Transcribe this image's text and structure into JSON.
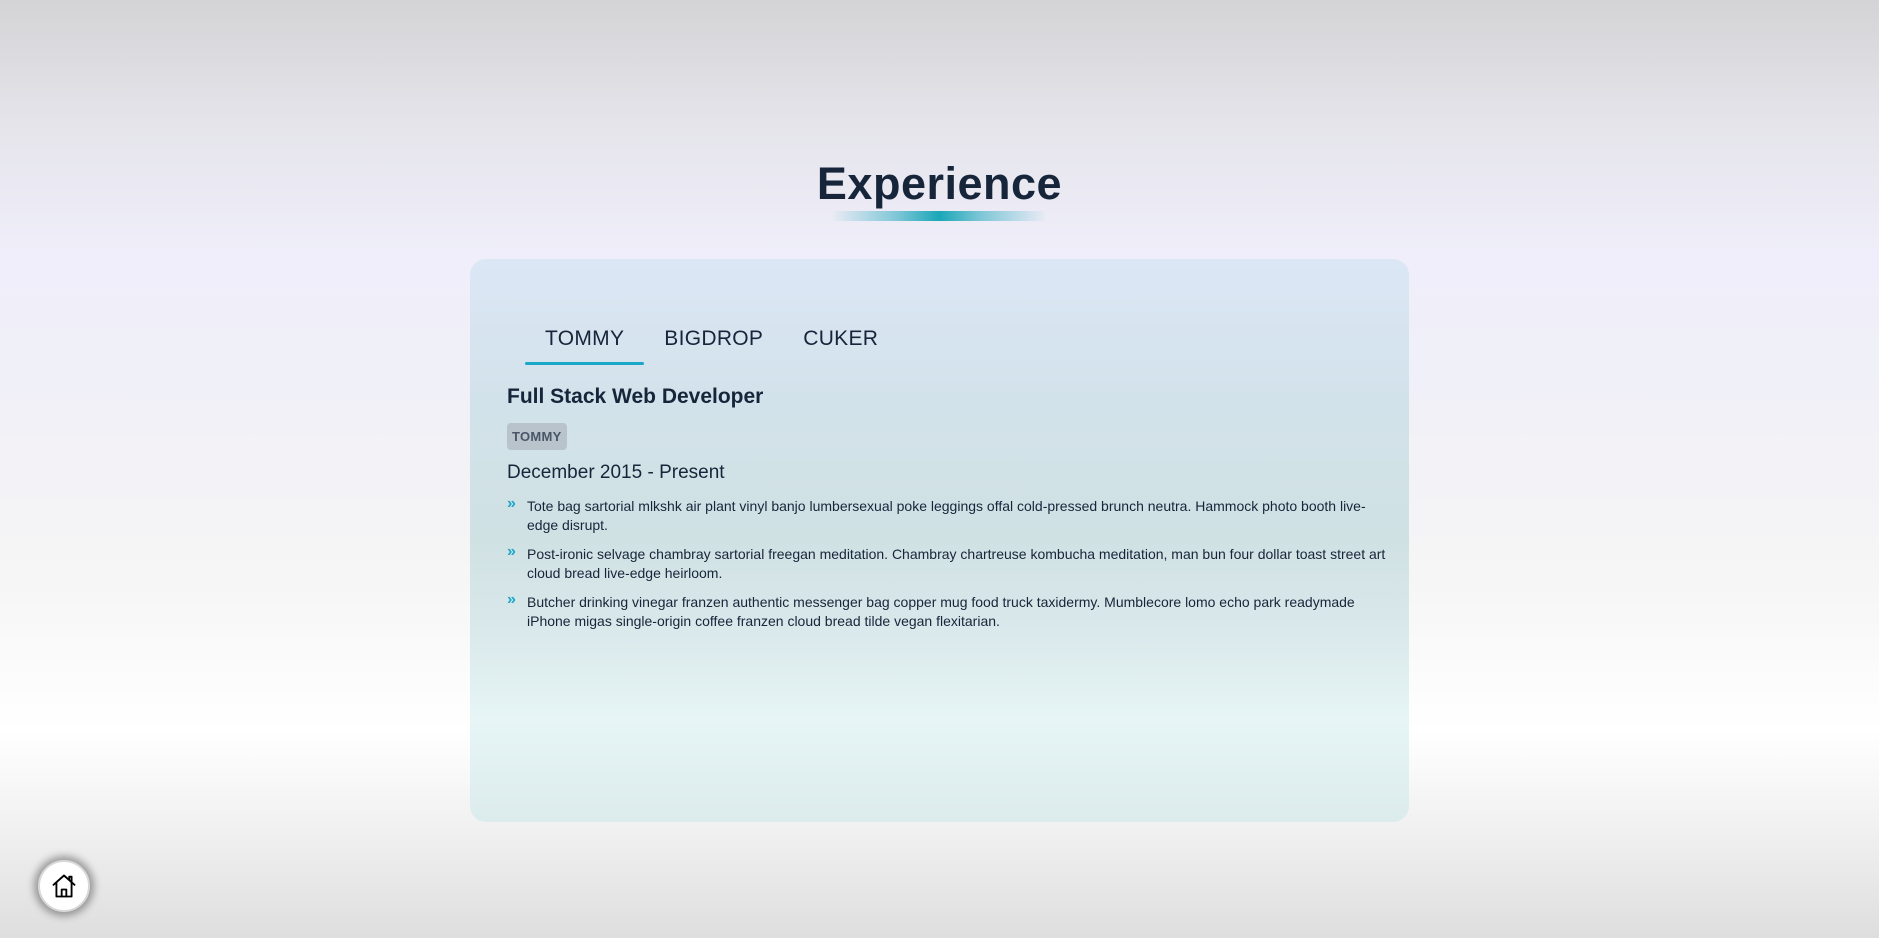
{
  "section": {
    "title": "Experience"
  },
  "tabs": [
    {
      "label": "TOMMY",
      "active": true
    },
    {
      "label": "BIGDROP",
      "active": false
    },
    {
      "label": "CUKER",
      "active": false
    }
  ],
  "job": {
    "title": "Full Stack Web Developer",
    "company": "TOMMY",
    "dates": "December 2015 - Present",
    "duties": [
      "Tote bag sartorial mlkshk air plant vinyl banjo lumbersexual poke leggings offal cold-pressed brunch neutra. Hammock photo booth live-edge disrupt.",
      "Post-ironic selvage chambray sartorial freegan meditation. Chambray chartreuse kombucha meditation, man bun four dollar toast street art cloud bread live-edge heirloom.",
      "Butcher drinking vinegar franzen authentic messenger bag copper mug food truck taxidermy. Mumblecore lomo echo park readymade iPhone migas single-origin coffee franzen cloud bread tilde vegan flexitarian."
    ],
    "duty_icon": "double-chevron-right-icon"
  },
  "home": {
    "icon": "home-icon"
  },
  "colors": {
    "accent": "#1aa7c8",
    "heading": "#17253a",
    "badge_bg": "#b9c3cc"
  }
}
